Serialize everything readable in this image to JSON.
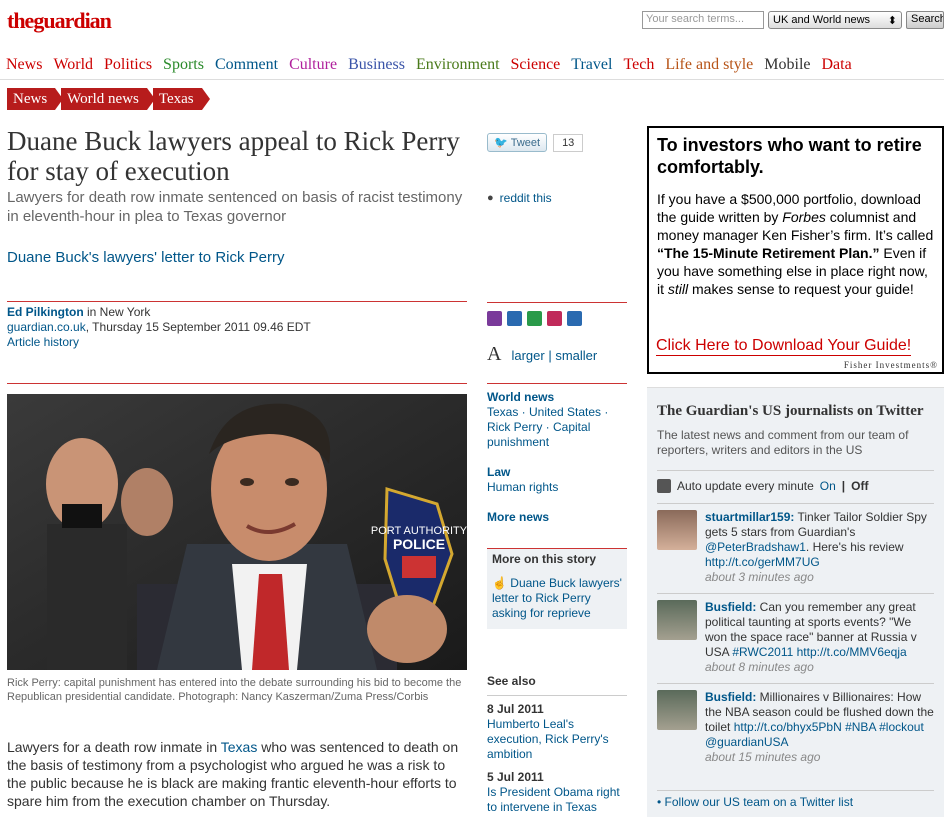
{
  "header": {
    "logo_the": "the",
    "logo_guardian": "guardian",
    "search_placeholder": "Your search terms...",
    "search_scope": "UK and World news",
    "search_button": "Search"
  },
  "nav": [
    {
      "label": "News",
      "color": "#c00"
    },
    {
      "label": "World",
      "color": "#c00"
    },
    {
      "label": "Politics",
      "color": "#c00"
    },
    {
      "label": "Sports",
      "color": "#2a8a2a"
    },
    {
      "label": "Comment",
      "color": "#005689"
    },
    {
      "label": "Culture",
      "color": "#b0209c"
    },
    {
      "label": "Business",
      "color": "#3a54a8"
    },
    {
      "label": "Environment",
      "color": "#4a7a1a"
    },
    {
      "label": "Science",
      "color": "#c00"
    },
    {
      "label": "Travel",
      "color": "#005689"
    },
    {
      "label": "Tech",
      "color": "#c00"
    },
    {
      "label": "Life and style",
      "color": "#b75418"
    },
    {
      "label": "Mobile",
      "color": "#333"
    },
    {
      "label": "Data",
      "color": "#c00"
    }
  ],
  "breadcrumb": [
    "News",
    "World news",
    "Texas"
  ],
  "article": {
    "headline": "Duane Buck lawyers appeal to Rick Perry for stay of execution",
    "standfirst": "Lawyers for death row inmate sentenced on basis of racist testimony in eleventh-hour in plea to Texas governor",
    "related_link": "Duane Buck's lawyers' letter to Rick Perry",
    "author": "Ed Pilkington",
    "author_location": " in New York",
    "source_line": "guardian.co.uk",
    "date_line": ", Thursday 15 September 2011 09.46 EDT",
    "history": "Article history",
    "badge_line1": "PORT AUTHORITY",
    "badge_line2": "POLICE",
    "caption": "Rick Perry: capital punishment has entered into the debate surrounding his bid to become the Republican presidential candidate. Photograph: Nancy Kaszerman/Zuma Press/Corbis",
    "body_pre": "Lawyers for a death row inmate in ",
    "body_link": "Texas",
    "body_post": " who was sentenced to death on the basis of testimony from a psychologist who argued he was a risk to the public because he is black are making frantic eleventh-hour efforts to spare him from the execution chamber on Thursday."
  },
  "social": {
    "tweet_label": "Tweet",
    "tweet_count": "13",
    "reddit": "reddit this",
    "larger": "larger",
    "separator": "|",
    "smaller": "smaller"
  },
  "sections": {
    "world_news": "World news",
    "world_items": "Texas · United States · Rick Perry · Capital punishment",
    "law": "Law",
    "law_items": "Human rights",
    "more_news": "More news"
  },
  "more_on_story": {
    "title": "More on this story",
    "item": "Duane Buck lawyers' letter to Rick Perry asking for reprieve"
  },
  "see_also": {
    "title": "See also",
    "items": [
      {
        "date": "8 Jul 2011",
        "link": "Humberto Leal's execution, Rick Perry's ambition"
      },
      {
        "date": "5 Jul 2011",
        "link": "Is President Obama right to intervene in Texas"
      }
    ]
  },
  "ad": {
    "title": "To investors who want to retire comfortably.",
    "body_1": "If you have a $500,000 portfolio, download the guide written by ",
    "body_forbes": "Forbes",
    "body_2": " columnist and money manager Ken Fisher’s firm. It’s called ",
    "body_bold": "“The 15-Minute Retirement Plan.”",
    "body_3": " Even if you have something else in place right now, it ",
    "body_still": "still",
    "body_4": " makes sense to request your guide!",
    "cta": "Click Here to Download Your Guide!",
    "brand": "Fisher Investments®"
  },
  "twitter": {
    "title": "The Guardian's US journalists on Twitter",
    "desc": "The latest news and comment from our team of reporters, writers and editors in the US",
    "update_label": "Auto update every minute",
    "on": "On",
    "sep": "|",
    "off": "Off",
    "tweets": [
      {
        "user": "stuartmillar159:",
        "text": " Tinker Tailor Soldier Spy gets 5 stars from Guardian's ",
        "mention": "@PeterBradshaw1",
        "text2": ". Here's his review ",
        "link": "http://t.co/gerMM7UG",
        "time": "about 3 minutes ago"
      },
      {
        "user": "Busfield:",
        "text": " Can you remember any great political taunting at sports events? \"We won the space race\" banner at Russia v USA ",
        "mention": "#RWC2011",
        "text2": " ",
        "link": "http://t.co/MMV6eqja",
        "time": "about 8 minutes ago"
      },
      {
        "user": "Busfield:",
        "text": " Millionaires v Billionaires: How the NBA season could be flushed down the toilet ",
        "mention": "http://t.co/bhyx5PbN",
        "text2": " ",
        "link": "#NBA #lockout @guardianUSA",
        "time": "about 15 minutes ago"
      }
    ],
    "follow": "• Follow our US team on a Twitter list"
  }
}
